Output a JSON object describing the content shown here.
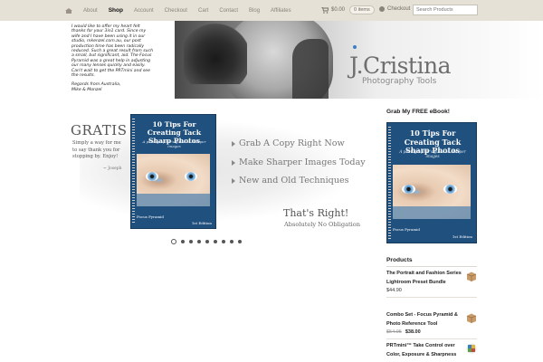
{
  "nav": {
    "home_icon": "home-icon",
    "items": [
      {
        "label": "About",
        "active": false
      },
      {
        "label": "Shop",
        "active": true
      },
      {
        "label": "Account",
        "active": false
      },
      {
        "label": "Checkout",
        "active": false
      },
      {
        "label": "Cart",
        "active": false
      },
      {
        "label": "Contact",
        "active": false
      },
      {
        "label": "Blog",
        "active": false
      },
      {
        "label": "Affiliates",
        "active": false
      }
    ]
  },
  "cart": {
    "icon": "cart-icon",
    "amount": "$0.00",
    "items_label": "0 items"
  },
  "checkout": {
    "icon": "gear-icon",
    "label": "Checkout"
  },
  "search": {
    "placeholder": "Search Products"
  },
  "testimonial": {
    "body": "I would like to offer my heart felt thanks for your 3in1 card. Since my wife and I have been using it in our studio, mkenzel.com.au, our post production time has been radically reduced. Such a great result from such a small, but significant, aid. The Focus Pyramid was a great help in adjusting our many lenses quickly and easily. Can't wait to get the PRTmini and see the results.",
    "signoff_1": "Regards from Australia,",
    "signoff_2": "Mike & Monzel"
  },
  "brand": {
    "name": "J.Cristina",
    "tagline": "Photography Tools",
    "accent": "#3a7fc0"
  },
  "slider": {
    "gratis": "GRATIS",
    "gratis_sub": "Simply a way for me to say thank you for stopping by. Enjoy!",
    "signature": "~ Joseph",
    "bullets": [
      "Grab A Copy Right Now",
      "Make Sharper Images Today",
      "New and Old Techniques"
    ],
    "thats_right": "That's Right!",
    "no_obligation": "Absolutely No Obligation",
    "slide_count": 9,
    "active_slide": 0
  },
  "book": {
    "title": "10 Tips For Creating Tack Sharp Photos",
    "subtitle": "A photographer's guide to sharper images",
    "footer_left": "Focus Pyramid",
    "footer_right": "1st Edition",
    "cover_color": "#20507e"
  },
  "sidebar": {
    "ebook_heading": "Grab My FREE eBook!",
    "products_heading": "Products",
    "products": [
      {
        "name": "The Portrait and Fashion Series Lightroom Preset Bundle",
        "old_price": "",
        "price": "$44.90",
        "thumb": "box-icon"
      },
      {
        "name": "Combo Set - Focus Pyramid & Photo Reference Tool",
        "old_price": "$54.95",
        "price": "$38.00",
        "thumb": "box-icon"
      },
      {
        "name": "PRTmini™ Take Control over Color, Exposure & Sharpness",
        "old_price": "",
        "price": "",
        "thumb": "color-chart-icon"
      }
    ]
  }
}
